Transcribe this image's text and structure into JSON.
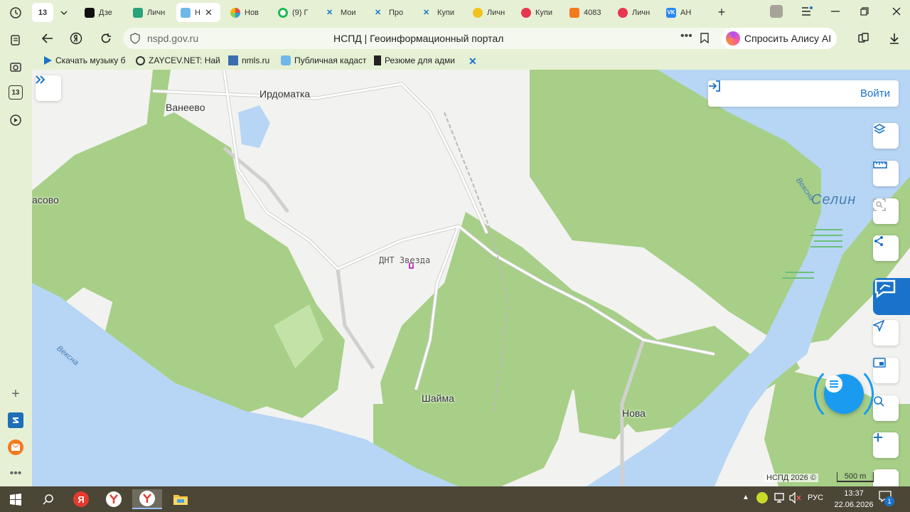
{
  "left_sidebar": {
    "badge": "13"
  },
  "tabs": [
    {
      "label": "13",
      "kind": "counter"
    },
    {
      "label": "Дзе"
    },
    {
      "label": "Личн"
    },
    {
      "label": "Н",
      "active": true
    },
    {
      "label": "Нов"
    },
    {
      "label": "(9) Г"
    },
    {
      "label": "Мои"
    },
    {
      "label": "Про"
    },
    {
      "label": "Купи"
    },
    {
      "label": "Личн"
    },
    {
      "label": "Купи"
    },
    {
      "label": "4083"
    },
    {
      "label": "Личн"
    },
    {
      "label": "АН"
    }
  ],
  "address_bar": {
    "url": "nspd.gov.ru",
    "page_title": "НСПД | Геоинформационный портал",
    "alice_button": "Спросить Алису AI"
  },
  "bookmarks": [
    {
      "label": "Скачать музыку б"
    },
    {
      "label": "ZAYCEV.NET: Най"
    },
    {
      "label": "nmls.ru"
    },
    {
      "label": "Публичная кадаст"
    },
    {
      "label": "Резюме для адми"
    }
  ],
  "map": {
    "login_button": "Войти",
    "labels": {
      "irdomatka": "Ирдоматка",
      "vaneevo": "Ванеево",
      "sovo": "асово",
      "dnt_zvezda": "ДНТ Звезда",
      "shaima": "Шайма",
      "nova": "Нова",
      "selin": "Селин",
      "vexna_1": "Вексна",
      "vexna_2": "Вексна"
    },
    "attribution": "НСПД 2026 ©",
    "scale": "500 m",
    "colors": {
      "water": "#b7d6f5",
      "forest": "#a7cf87",
      "land": "#f2f2f0",
      "accent": "#1a73c9"
    }
  },
  "taskbar": {
    "language": "РУС",
    "time": "13:37",
    "date": "22.06.2026",
    "notifications": "1"
  }
}
